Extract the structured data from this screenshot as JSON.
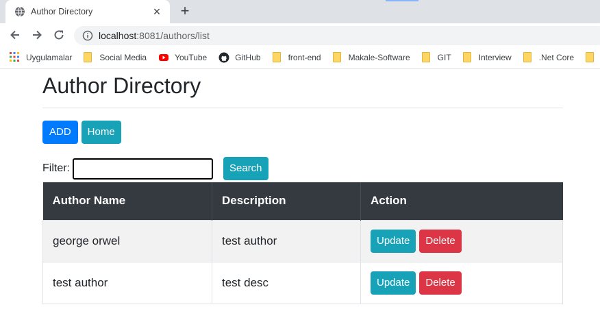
{
  "browser": {
    "tab_title": "Author Directory",
    "new_tab_label": "+",
    "url_host": "localhost",
    "url_rest": ":8081/authors/list",
    "bookmarks": [
      {
        "label": "Uygulamalar",
        "icon": "apps-grid-icon"
      },
      {
        "label": "Social Media",
        "icon": "folder-icon"
      },
      {
        "label": "YouTube",
        "icon": "youtube-icon"
      },
      {
        "label": "GitHub",
        "icon": "github-icon"
      },
      {
        "label": "front-end",
        "icon": "folder-icon"
      },
      {
        "label": "Makale-Software",
        "icon": "folder-icon"
      },
      {
        "label": "GIT",
        "icon": "folder-icon"
      },
      {
        "label": "Interview",
        "icon": "folder-icon"
      },
      {
        "label": ".Net Core",
        "icon": "folder-icon"
      }
    ]
  },
  "page": {
    "title": "Author Directory",
    "add_label": "ADD",
    "home_label": "Home",
    "filter_label": "Filter:",
    "filter_value": "",
    "search_label": "Search"
  },
  "table": {
    "headers": [
      "Author Name",
      "Description",
      "Action"
    ],
    "rows": [
      {
        "name": "george orwel",
        "description": "test author",
        "update_label": "Update",
        "delete_label": "Delete"
      },
      {
        "name": "test author",
        "description": "test desc",
        "update_label": "Update",
        "delete_label": "Delete"
      }
    ]
  },
  "colors": {
    "primary": "#007bff",
    "info": "#17a2b8",
    "danger": "#dc3545",
    "table_header": "#343a40"
  }
}
